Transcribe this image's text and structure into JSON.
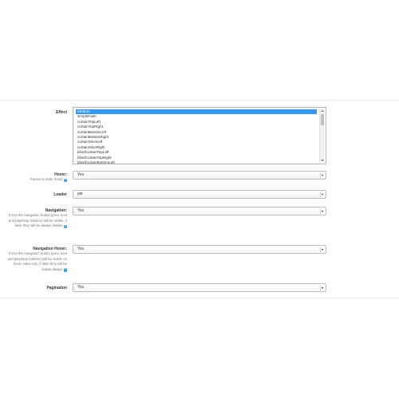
{
  "form": {
    "effect": {
      "label": "Effect",
      "options": [
        "random",
        "simpleFade",
        "curtainTopLeft",
        "curtainTopRight",
        "curtainBottomLeft",
        "curtainBottomRight",
        "curtainSliceLeft",
        "curtainSliceRight",
        "blindCurtainTopLeft",
        "blindCurtainTopRight",
        "blindCurtainBottomLeft"
      ],
      "selected_index": 0
    },
    "hover": {
      "label": "Hover:",
      "help": "Pause on state hover",
      "value": "Yes"
    },
    "loader": {
      "label": "Loader",
      "value": "pie"
    },
    "navigation": {
      "label": "Navigation:",
      "help": "If true the navigation button (prev, next and play/stop buttons) will be visible, if false they will be always hidden",
      "value": "Yes"
    },
    "navigation_hover": {
      "label": "Navigation Hover:",
      "help": "If true the navigation button (prev, next and play/stop buttons) will be visible on hover state only, if false they will be visible always",
      "value": "Yes"
    },
    "pagination": {
      "label": "Pagination",
      "value": "Yes"
    }
  },
  "icons": {
    "help": "question-circle-icon",
    "dropdown": "caret-down-icon"
  },
  "colors": {
    "selection": "#3399ff",
    "help_icon": "#2e8ece"
  }
}
